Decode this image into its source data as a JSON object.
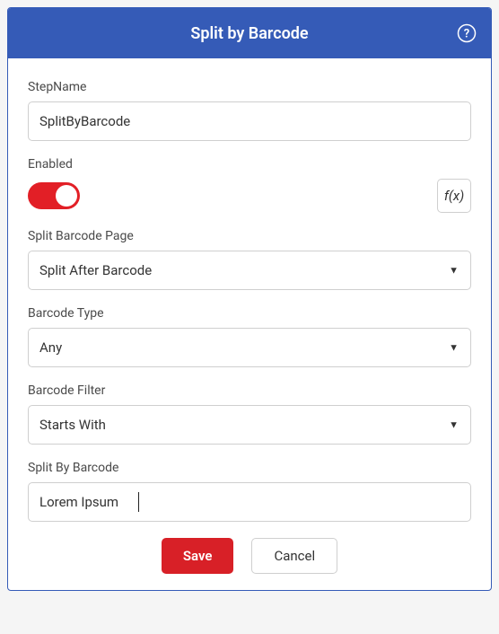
{
  "header": {
    "title": "Split by Barcode",
    "help_label": "help"
  },
  "fields": {
    "stepName": {
      "label": "StepName",
      "value": "SplitByBarcode"
    },
    "enabled": {
      "label": "Enabled",
      "on": true,
      "fx_label": "f(x)"
    },
    "splitBarcodePage": {
      "label": "Split Barcode Page",
      "value": "Split After Barcode"
    },
    "barcodeType": {
      "label": "Barcode Type",
      "value": "Any"
    },
    "barcodeFilter": {
      "label": "Barcode Filter",
      "value": "Starts With"
    },
    "splitByBarcode": {
      "label": "Split By Barcode",
      "value": "Lorem Ipsum"
    }
  },
  "actions": {
    "save": "Save",
    "cancel": "Cancel"
  }
}
